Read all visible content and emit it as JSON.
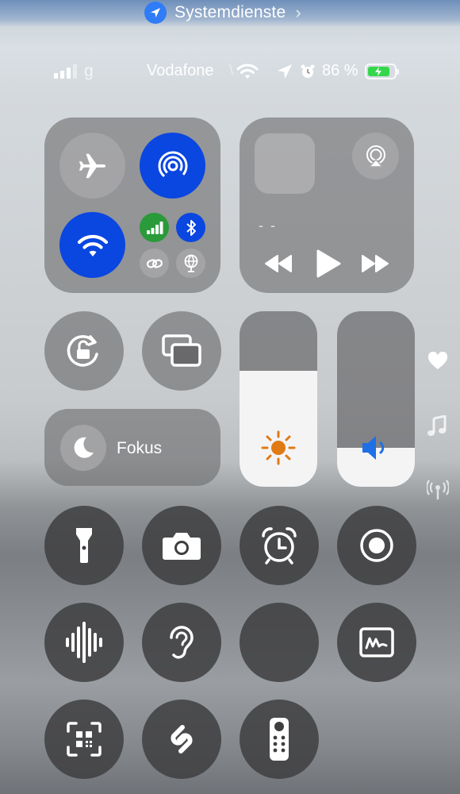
{
  "top_banner": {
    "label": "Systemdienste",
    "icons": [
      "location-arrow-icon",
      "chevron-right-icon"
    ]
  },
  "status_bar": {
    "signal_suffix": "g",
    "carrier": "Vodafone",
    "battery_percent_text": "86 %",
    "battery_level": 0.86,
    "icons": [
      "cellular-signal-icon",
      "wifi-icon",
      "location-icon",
      "alarm-icon",
      "battery-charging-icon"
    ]
  },
  "connectivity": {
    "airplane": {
      "icon": "airplane-icon",
      "active": false
    },
    "airdrop": {
      "icon": "airdrop-icon",
      "active": true
    },
    "wifi": {
      "icon": "wifi-icon",
      "active": true
    },
    "cellular": {
      "icon": "cellular-icon",
      "active": true
    },
    "bluetooth": {
      "icon": "bluetooth-icon",
      "active": true
    },
    "personal_hotspot": {
      "icon": "link-icon",
      "active": false
    },
    "vpn": {
      "icon": "globe-icon",
      "active": false
    }
  },
  "media": {
    "title_placeholder": "- -",
    "icons": [
      "artwork-placeholder",
      "airplay-icon",
      "rewind-icon",
      "play-icon",
      "fast-forward-icon"
    ]
  },
  "focus": {
    "label": "Fokus",
    "icon": "moon-icon"
  },
  "brightness": {
    "level": 0.66,
    "icon": "sun-icon"
  },
  "volume": {
    "level": 0.22,
    "icon": "speaker-icon"
  },
  "side_indicators": [
    "heart-icon",
    "music-note-icon",
    "antenna-icon"
  ],
  "controls": [
    "orientation-lock-icon",
    "screen-mirroring-icon",
    "flashlight-icon",
    "camera-icon",
    "alarm-clock-icon",
    "screen-record-icon",
    "voice-memo-icon",
    "hearing-icon",
    "empty-control",
    "notes-icon",
    "qr-code-icon",
    "shazam-icon",
    "apple-tv-remote-icon"
  ],
  "colors": {
    "accent_blue": "#0a46e0",
    "green": "#2a9a3a",
    "sun_orange": "#e07a14",
    "speaker_blue": "#1f6fe6",
    "battery_green": "#32d74b"
  }
}
